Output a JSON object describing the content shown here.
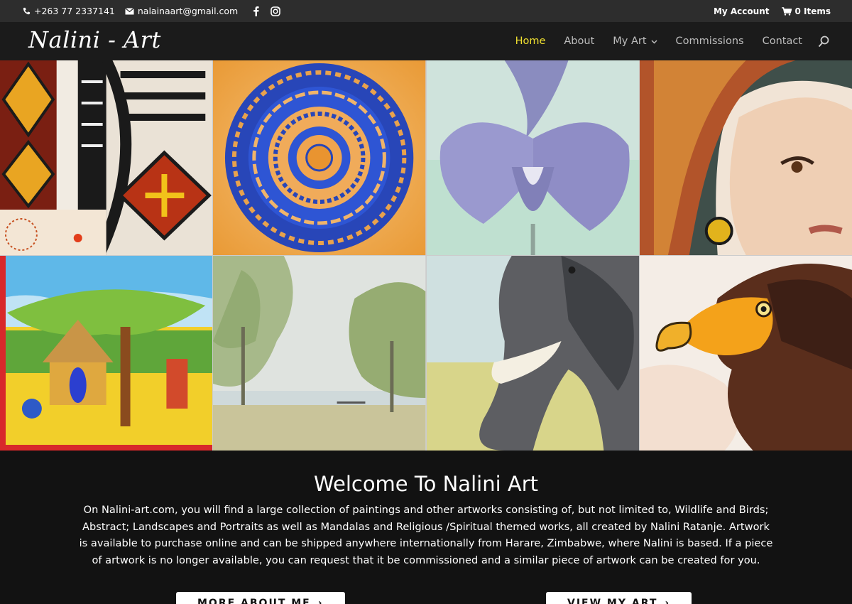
{
  "topbar": {
    "phone": "+263 77 2337141",
    "email": "nalainaart@gmail.com",
    "account": "My Account",
    "cart": "0 Items"
  },
  "header": {
    "logo": "Nalini - Art",
    "nav": [
      {
        "label": "Home",
        "active": true
      },
      {
        "label": "About"
      },
      {
        "label": "My Art",
        "has_dropdown": true
      },
      {
        "label": "Commissions"
      },
      {
        "label": "Contact"
      }
    ]
  },
  "gallery": [
    {
      "name": "tribal-pattern-painting"
    },
    {
      "name": "blue-mandala-painting"
    },
    {
      "name": "purple-iris-painting"
    },
    {
      "name": "african-woman-portrait"
    },
    {
      "name": "village-hut-painting"
    },
    {
      "name": "river-landscape-painting"
    },
    {
      "name": "elephant-painting"
    },
    {
      "name": "eagle-painting"
    }
  ],
  "welcome": {
    "title": "Welcome To Nalini Art",
    "body": "On Nalini-art.com, you will find a large collection of paintings and other artworks consisting of, but not limited to, Wildlife and Birds; Abstract; Landscapes and Portraits as well as Mandalas and Religious /Spiritual themed works, all created by Nalini Ratanje. Artwork is available to purchase online and can be shipped anywhere internationally from Harare, Zimbabwe, where Nalini is based. If a piece of artwork is no longer available, you can request that it be commissioned and a similar piece of artwork can be created for you.",
    "btn_about": "MORE ABOUT ME",
    "btn_art": "VIEW MY ART"
  }
}
